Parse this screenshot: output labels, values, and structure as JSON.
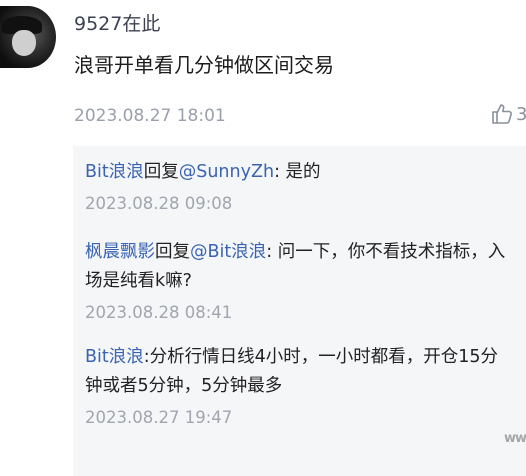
{
  "post": {
    "username": "9527在此",
    "text": "浪哥开单看几分钟做区间交易",
    "time": "2023.08.27 18:01",
    "avatar_icon": "avatar-portrait",
    "like_icon": "thumbs-up-icon",
    "like_count_partial": "3"
  },
  "replies": [
    {
      "author": "Bit浪浪",
      "reply_word": "回复",
      "target": "@SunnyZh",
      "content": ": 是的",
      "time": "2023.08.28 09:08"
    },
    {
      "author": "枫晨飘影",
      "reply_word": "回复",
      "target": "@Bit浪浪",
      "content": ": 问一下，你不看技术指标，入场是纯看k嘛?",
      "time": "2023.08.28 08:41"
    },
    {
      "author": "Bit浪浪",
      "content": ":分析行情日线4小时，一小时都看，开仓15分钟或者5分钟，5分钟最多",
      "time": "2023.08.27 19:47"
    }
  ],
  "watermark": "ww",
  "colors": {
    "link": "#3a64b2",
    "meta": "#9aa0ab",
    "reply_bg": "#f5f6f8"
  }
}
